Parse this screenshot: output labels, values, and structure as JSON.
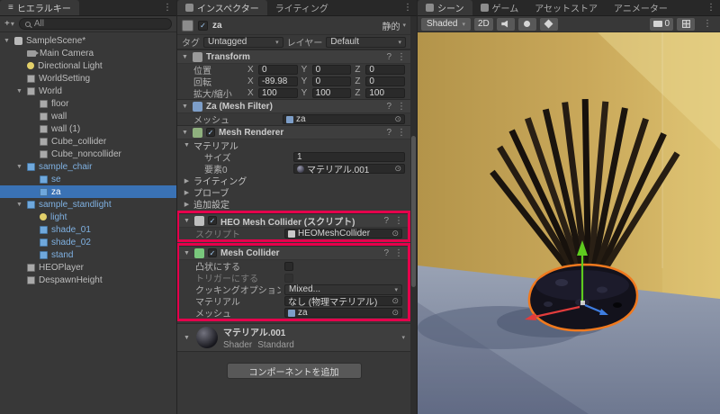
{
  "hierarchy": {
    "tab_title": "ヒエラルキー",
    "create_label": "+",
    "search_text": "All",
    "items": [
      {
        "label": "SampleScene*"
      },
      {
        "label": "Main Camera"
      },
      {
        "label": "Directional Light"
      },
      {
        "label": "WorldSetting"
      },
      {
        "label": "World"
      },
      {
        "label": "floor"
      },
      {
        "label": "wall"
      },
      {
        "label": "wall (1)"
      },
      {
        "label": "Cube_collider"
      },
      {
        "label": "Cube_noncollider"
      },
      {
        "label": "sample_chair"
      },
      {
        "label": "se"
      },
      {
        "label": "za"
      },
      {
        "label": "sample_standlight"
      },
      {
        "label": "light"
      },
      {
        "label": "shade_01"
      },
      {
        "label": "shade_02"
      },
      {
        "label": "stand"
      },
      {
        "label": "HEOPlayer"
      },
      {
        "label": "DespawnHeight"
      }
    ]
  },
  "inspector": {
    "tab_main": "インスペクター",
    "tab_lighting": "ライティング",
    "header": {
      "name": "za",
      "static_label": "静的"
    },
    "tag_label": "タグ",
    "tag_value": "Untagged",
    "layer_label": "レイヤー",
    "layer_value": "Default",
    "transform": {
      "title": "Transform",
      "ax": {
        "x": "X",
        "y": "Y",
        "z": "Z"
      },
      "rows": [
        {
          "label": "位置",
          "x": "0",
          "y": "0",
          "z": "0"
        },
        {
          "label": "回転",
          "x": "-89.98",
          "y": "0",
          "z": "0"
        },
        {
          "label": "拡大/縮小",
          "x": "100",
          "y": "100",
          "z": "100"
        }
      ]
    },
    "mesh_filter": {
      "title": "Za (Mesh Filter)",
      "mesh_label": "メッシュ",
      "mesh_value": "za"
    },
    "mesh_renderer": {
      "title": "Mesh Renderer",
      "materials_label": "マテリアル",
      "size_label": "サイズ",
      "size_value": "1",
      "element_label": "要素0",
      "element_value": "マテリアル.001",
      "lighting_label": "ライティング",
      "probes_label": "プローブ",
      "additional_label": "追加設定"
    },
    "heo_collider": {
      "title": "HEO Mesh Collider (スクリプト)",
      "script_label": "スクリプト",
      "script_value": "HEOMeshCollider"
    },
    "mesh_collider": {
      "title": "Mesh Collider",
      "convex_label": "凸状にする",
      "trigger_label": "トリガーにする",
      "cooking_label": "クッキングオプション",
      "cooking_value": "Mixed...",
      "material_label": "マテリアル",
      "material_value": "なし (物理マテリアル)",
      "mesh_label": "メッシュ",
      "mesh_value": "za"
    },
    "material_preview": {
      "name": "マテリアル.001",
      "shader_label": "Shader",
      "shader_value": "Standard"
    },
    "add_component_label": "コンポーネントを追加"
  },
  "scene": {
    "tab_scene": "シーン",
    "tab_game": "ゲーム",
    "tab_asset_store": "アセットストア",
    "tab_animator": "アニメーター",
    "toolbar": {
      "shading_mode": "Shaded",
      "mode_2d": "2D",
      "camera_count": "0"
    }
  },
  "colors": {
    "annotation_red": "#E5004C",
    "selection_blue": "#3A72B5",
    "prefab_text_blue": "#7FB1E2",
    "selection_outline_orange": "#F0791E",
    "gizmo_green": "#5ECB1F",
    "gizmo_red": "#E23C3C",
    "gizmo_blue": "#3E7DE0"
  }
}
